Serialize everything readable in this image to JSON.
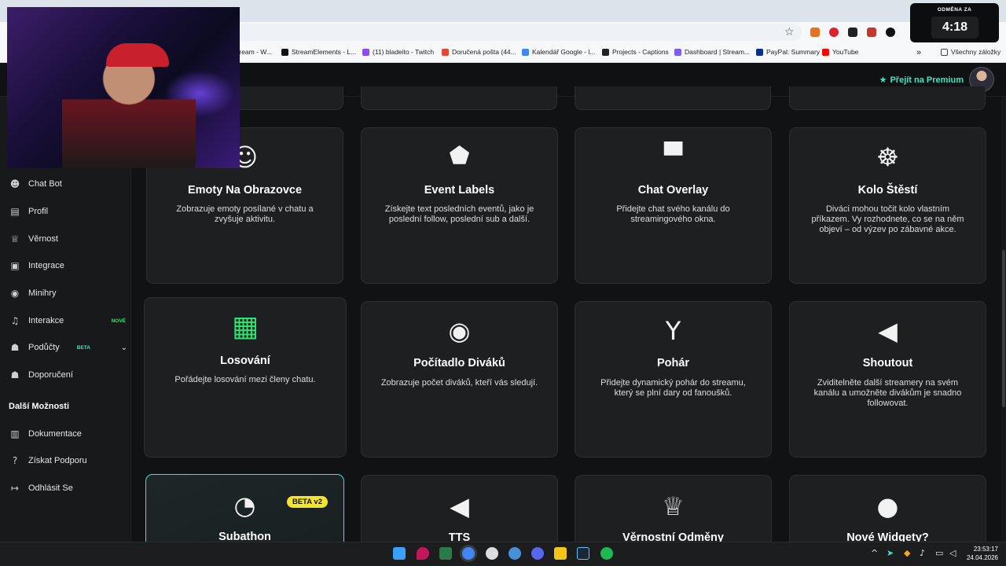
{
  "browser": {
    "bookmarks": [
      {
        "label": "tream - W...",
        "color": "#6441a5"
      },
      {
        "label": "StreamElements - L...",
        "color": "#111111"
      },
      {
        "label": "(11) bladeito - Twitch",
        "color": "#9146ff"
      },
      {
        "label": "Doručená pošta (44...",
        "color": "#ea4335"
      },
      {
        "label": "Kalendář Google - l...",
        "color": "#4285f4"
      },
      {
        "label": "Projects - Captions",
        "color": "#222222"
      },
      {
        "label": "Dashboard | Stream...",
        "color": "#7b5cff"
      },
      {
        "label": "PayPal: Summary",
        "color": "#003087"
      },
      {
        "label": "YouTube",
        "color": "#ff0000"
      }
    ],
    "more_bookmarks": "»",
    "all_bookmarks": "Všechny záložky"
  },
  "timer": {
    "label": "ODMĚNA ZA",
    "value": "4:18"
  },
  "topbar": {
    "premium_label": "Přejít na Premium"
  },
  "sidebar": {
    "items": [
      {
        "label": "Chat Bot",
        "icon": "robot-icon"
      },
      {
        "label": "Profil",
        "icon": "id-card-icon"
      },
      {
        "label": "Věrnost",
        "icon": "trophy-icon"
      },
      {
        "label": "Integrace",
        "icon": "plug-icon"
      },
      {
        "label": "Minihry",
        "icon": "gamepad-icon"
      },
      {
        "label": "Interakce",
        "icon": "music-icon",
        "badge": "NOVÉ"
      },
      {
        "label": "Podůčty",
        "icon": "users-icon",
        "badge": "BETA"
      },
      {
        "label": "Doporučení",
        "icon": "user-group-icon"
      }
    ],
    "section_title": "Další Možnosti",
    "more_items": [
      {
        "label": "Dokumentace",
        "icon": "book-icon"
      },
      {
        "label": "Získat Podporu",
        "icon": "question-icon"
      },
      {
        "label": "Odhlásit Se",
        "icon": "logout-icon"
      }
    ]
  },
  "cards": [
    {
      "title": "Emoty Na Obrazovce",
      "desc": "Zobrazuje emoty posílané v chatu a zvyšuje aktivitu.",
      "icon": "emoji-icon"
    },
    {
      "title": "Event Labels",
      "desc": "Získejte text posledních eventů, jako je poslední follow, poslední sub a další.",
      "icon": "tags-icon"
    },
    {
      "title": "Chat Overlay",
      "desc": "Přidejte chat svého kanálu do streamingového okna.",
      "icon": "chat-bubble-icon"
    },
    {
      "title": "Kolo Štěstí",
      "desc": "Diváci mohou točit kolo vlastním příkazem. Vy rozhodnete, co se na něm objeví – od výzev po zábavné akce.",
      "icon": "wheel-icon"
    },
    {
      "title": "Losování",
      "desc": "Pořádejte losování mezi členy chatu.",
      "icon": "gift-icon"
    },
    {
      "title": "Počítadlo Diváků",
      "desc": "Zobrazuje počet diváků, kteří vás sledují.",
      "icon": "eye-icon"
    },
    {
      "title": "Pohár",
      "desc": "Přidejte dynamický pohár do streamu, který se plní dary od fanoušků.",
      "icon": "cocktail-icon"
    },
    {
      "title": "Shoutout",
      "desc": "Zviditelněte další streamery na svém kanálu a umožněte divákům je snadno followovat.",
      "icon": "megaphone-icon"
    },
    {
      "title": "Subathon",
      "desc": "",
      "icon": "clock-icon",
      "badge": "BETA v2"
    },
    {
      "title": "TTS",
      "desc": "",
      "icon": "speaker-icon"
    },
    {
      "title": "Věrnostní Odměny",
      "desc": "",
      "icon": "trophy-icon"
    },
    {
      "title": "Nové Widgety?",
      "desc": "",
      "icon": "lightbulb-icon"
    }
  ],
  "taskbar": {
    "clock_time": "23:53:17",
    "clock_date": "24.04.2026"
  }
}
